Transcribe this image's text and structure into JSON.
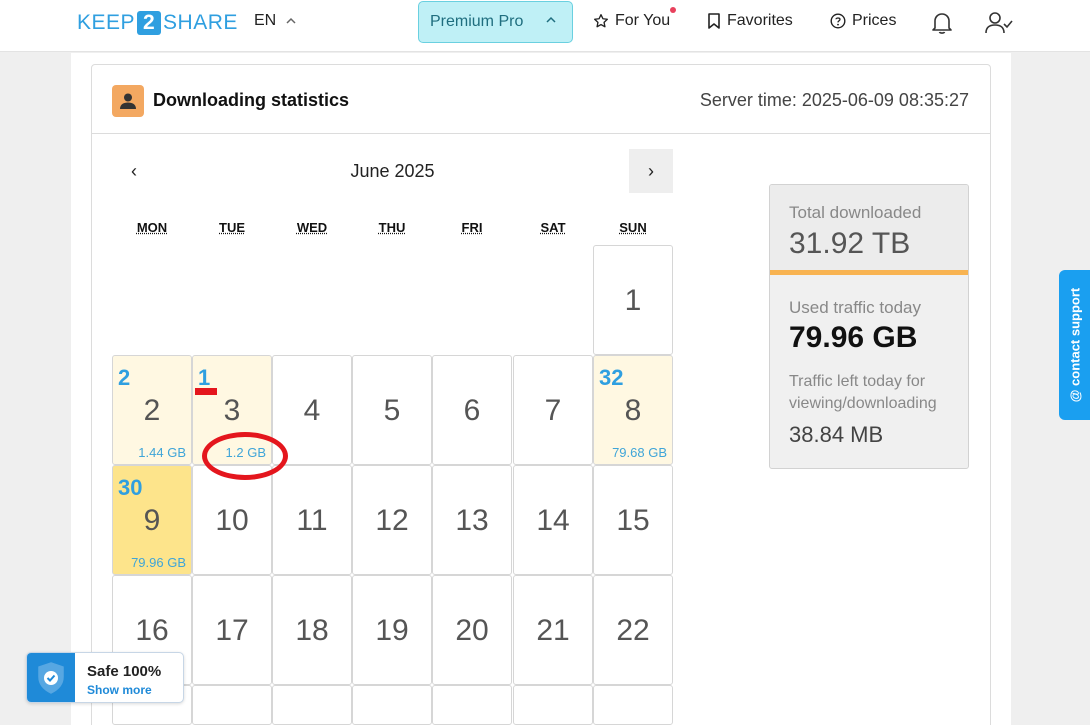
{
  "header": {
    "logo": {
      "pre": "KEEP",
      "mid": "2",
      "post": "SHARE"
    },
    "language": "EN",
    "premium_label": "Premium Pro",
    "nav": {
      "for_you": "For You",
      "favorites": "Favorites",
      "prices": "Prices"
    },
    "colors": {
      "brand": "#2f9fe0",
      "premium_bg": "#bff0f6",
      "notification_dot": "#e8415d"
    }
  },
  "card": {
    "title": "Downloading statistics",
    "server_time": "Server time: 2025-06-09 08:35:27"
  },
  "calendar": {
    "month_label": "June 2025",
    "prev_label": "‹",
    "next_label": "›",
    "weekdays": [
      "MON",
      "TUE",
      "WED",
      "THU",
      "FRI",
      "SAT",
      "SUN"
    ],
    "days": {
      "d1": {
        "day": "1"
      },
      "d2": {
        "day": "2",
        "files": "2",
        "size": "1.44 GB"
      },
      "d3": {
        "day": "3",
        "files": "1",
        "size": "1.2 GB"
      },
      "d4": {
        "day": "4"
      },
      "d5": {
        "day": "5"
      },
      "d6": {
        "day": "6"
      },
      "d7": {
        "day": "7"
      },
      "d8": {
        "day": "8",
        "files": "32",
        "size": "79.68 GB"
      },
      "d9": {
        "day": "9",
        "files": "30",
        "size": "79.96 GB"
      },
      "d10": {
        "day": "10"
      },
      "d11": {
        "day": "11"
      },
      "d12": {
        "day": "12"
      },
      "d13": {
        "day": "13"
      },
      "d14": {
        "day": "14"
      },
      "d15": {
        "day": "15"
      },
      "d16": {
        "day": "16"
      },
      "d17": {
        "day": "17"
      },
      "d18": {
        "day": "18"
      },
      "d19": {
        "day": "19"
      },
      "d20": {
        "day": "20"
      },
      "d21": {
        "day": "21"
      },
      "d22": {
        "day": "22"
      }
    }
  },
  "stats": {
    "total_label": "Total downloaded",
    "total_value": "31.92 TB",
    "used_label": "Used traffic today",
    "used_value": "79.96 GB",
    "left_label": "Traffic left today for viewing/downloading",
    "left_value": "38.84 MB",
    "accent": "#f8b351"
  },
  "support_label": "@ contact support",
  "safe_badge": {
    "title": "Safe 100%",
    "link": "Show more"
  }
}
